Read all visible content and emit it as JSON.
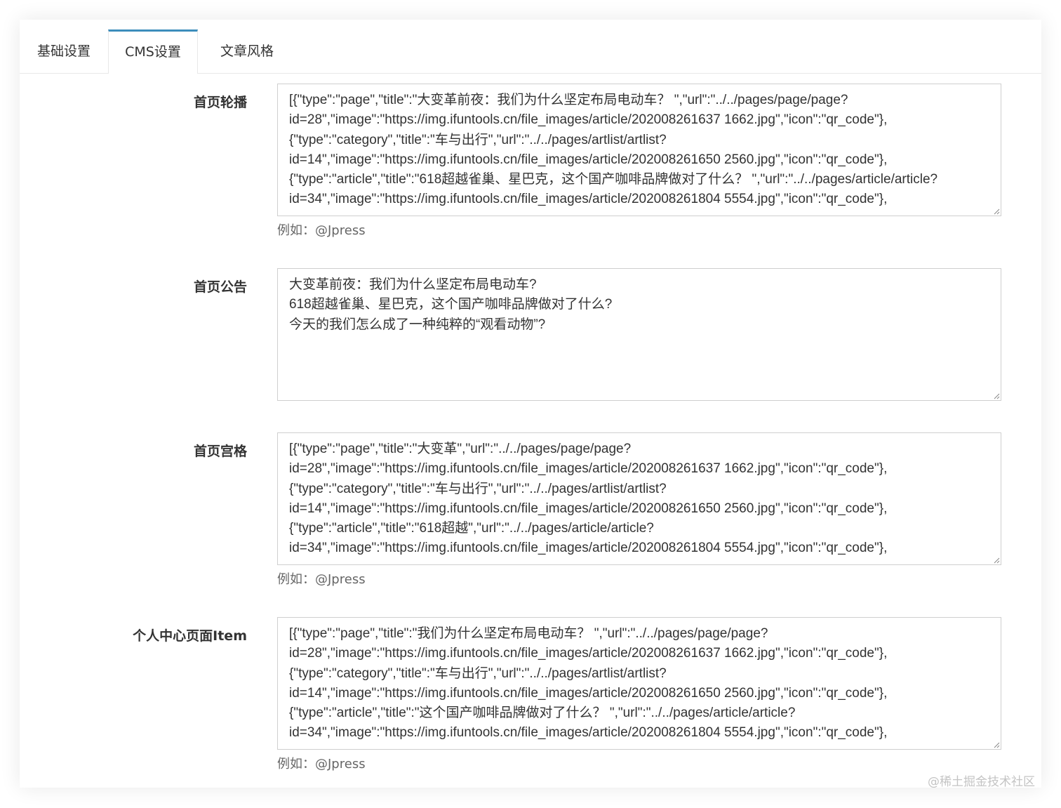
{
  "tabs": [
    {
      "label": "基础设置"
    },
    {
      "label": "CMS设置",
      "active": true
    },
    {
      "label": "文章风格"
    }
  ],
  "fields": [
    {
      "label": "首页轮播",
      "value": "[{\"type\":\"page\",\"title\":\"大变革前夜：我们为什么坚定布局电动车？ \",\"url\":\"../../pages/page/page?\nid=28\",\"image\":\"https://img.ifuntools.cn/file_images/article/202008261637 1662.jpg\",\"icon\":\"qr_code\"},\n{\"type\":\"category\",\"title\":\"车与出行\",\"url\":\"../../pages/artlist/artlist?\nid=14\",\"image\":\"https://img.ifuntools.cn/file_images/article/202008261650 2560.jpg\",\"icon\":\"qr_code\"},\n{\"type\":\"article\",\"title\":\"618超越雀巢、星巴克，这个国产咖啡品牌做对了什么？ \",\"url\":\"../../pages/article/article?\nid=34\",\"image\":\"https://img.ifuntools.cn/file_images/article/202008261804 5554.jpg\",\"icon\":\"qr_code\"},",
      "help": "例如：@Jpress"
    },
    {
      "label": "首页公告",
      "value": "大变革前夜：我们为什么坚定布局电动车?\n618超越雀巢、星巴克，这个国产咖啡品牌做对了什么?\n今天的我们怎么成了一种纯粹的“观看动物”?",
      "help": ""
    },
    {
      "label": "首页宫格",
      "value": "[{\"type\":\"page\",\"title\":\"大变革\",\"url\":\"../../pages/page/page?\nid=28\",\"image\":\"https://img.ifuntools.cn/file_images/article/202008261637 1662.jpg\",\"icon\":\"qr_code\"},\n{\"type\":\"category\",\"title\":\"车与出行\",\"url\":\"../../pages/artlist/artlist?\nid=14\",\"image\":\"https://img.ifuntools.cn/file_images/article/202008261650 2560.jpg\",\"icon\":\"qr_code\"},\n{\"type\":\"article\",\"title\":\"618超越\",\"url\":\"../../pages/article/article?\nid=34\",\"image\":\"https://img.ifuntools.cn/file_images/article/202008261804 5554.jpg\",\"icon\":\"qr_code\"},",
      "help": "例如：@Jpress"
    },
    {
      "label": "个人中心页面Item",
      "value": "[{\"type\":\"page\",\"title\":\"我们为什么坚定布局电动车？ \",\"url\":\"../../pages/page/page?\nid=28\",\"image\":\"https://img.ifuntools.cn/file_images/article/202008261637 1662.jpg\",\"icon\":\"qr_code\"},\n{\"type\":\"category\",\"title\":\"车与出行\",\"url\":\"../../pages/artlist/artlist?\nid=14\",\"image\":\"https://img.ifuntools.cn/file_images/article/202008261650 2560.jpg\",\"icon\":\"qr_code\"},\n{\"type\":\"article\",\"title\":\"这个国产咖啡品牌做对了什么？ \",\"url\":\"../../pages/article/article?\nid=34\",\"image\":\"https://img.ifuntools.cn/file_images/article/202008261804 5554.jpg\",\"icon\":\"qr_code\"},",
      "help": "例如：@Jpress"
    }
  ],
  "watermark": "@稀土掘金技术社区",
  "colors": {
    "tab_active_border": "#3c8dbc",
    "input_border": "#cfcfcf"
  }
}
